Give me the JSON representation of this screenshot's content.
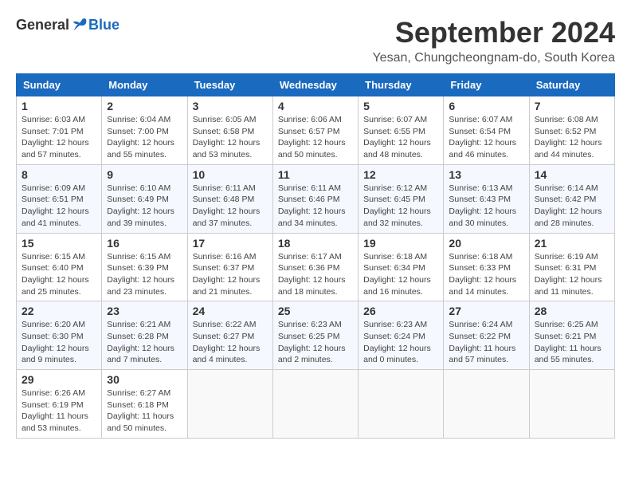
{
  "header": {
    "logo": {
      "general": "General",
      "blue": "Blue"
    },
    "title": "September 2024",
    "location": "Yesan, Chungcheongnam-do, South Korea"
  },
  "calendar": {
    "days_of_week": [
      "Sunday",
      "Monday",
      "Tuesday",
      "Wednesday",
      "Thursday",
      "Friday",
      "Saturday"
    ],
    "weeks": [
      [
        {
          "day": 1,
          "sunrise": "6:03 AM",
          "sunset": "7:01 PM",
          "daylight": "12 hours and 57 minutes."
        },
        {
          "day": 2,
          "sunrise": "6:04 AM",
          "sunset": "7:00 PM",
          "daylight": "12 hours and 55 minutes."
        },
        {
          "day": 3,
          "sunrise": "6:05 AM",
          "sunset": "6:58 PM",
          "daylight": "12 hours and 53 minutes."
        },
        {
          "day": 4,
          "sunrise": "6:06 AM",
          "sunset": "6:57 PM",
          "daylight": "12 hours and 50 minutes."
        },
        {
          "day": 5,
          "sunrise": "6:07 AM",
          "sunset": "6:55 PM",
          "daylight": "12 hours and 48 minutes."
        },
        {
          "day": 6,
          "sunrise": "6:07 AM",
          "sunset": "6:54 PM",
          "daylight": "12 hours and 46 minutes."
        },
        {
          "day": 7,
          "sunrise": "6:08 AM",
          "sunset": "6:52 PM",
          "daylight": "12 hours and 44 minutes."
        }
      ],
      [
        {
          "day": 8,
          "sunrise": "6:09 AM",
          "sunset": "6:51 PM",
          "daylight": "12 hours and 41 minutes."
        },
        {
          "day": 9,
          "sunrise": "6:10 AM",
          "sunset": "6:49 PM",
          "daylight": "12 hours and 39 minutes."
        },
        {
          "day": 10,
          "sunrise": "6:11 AM",
          "sunset": "6:48 PM",
          "daylight": "12 hours and 37 minutes."
        },
        {
          "day": 11,
          "sunrise": "6:11 AM",
          "sunset": "6:46 PM",
          "daylight": "12 hours and 34 minutes."
        },
        {
          "day": 12,
          "sunrise": "6:12 AM",
          "sunset": "6:45 PM",
          "daylight": "12 hours and 32 minutes."
        },
        {
          "day": 13,
          "sunrise": "6:13 AM",
          "sunset": "6:43 PM",
          "daylight": "12 hours and 30 minutes."
        },
        {
          "day": 14,
          "sunrise": "6:14 AM",
          "sunset": "6:42 PM",
          "daylight": "12 hours and 28 minutes."
        }
      ],
      [
        {
          "day": 15,
          "sunrise": "6:15 AM",
          "sunset": "6:40 PM",
          "daylight": "12 hours and 25 minutes."
        },
        {
          "day": 16,
          "sunrise": "6:15 AM",
          "sunset": "6:39 PM",
          "daylight": "12 hours and 23 minutes."
        },
        {
          "day": 17,
          "sunrise": "6:16 AM",
          "sunset": "6:37 PM",
          "daylight": "12 hours and 21 minutes."
        },
        {
          "day": 18,
          "sunrise": "6:17 AM",
          "sunset": "6:36 PM",
          "daylight": "12 hours and 18 minutes."
        },
        {
          "day": 19,
          "sunrise": "6:18 AM",
          "sunset": "6:34 PM",
          "daylight": "12 hours and 16 minutes."
        },
        {
          "day": 20,
          "sunrise": "6:18 AM",
          "sunset": "6:33 PM",
          "daylight": "12 hours and 14 minutes."
        },
        {
          "day": 21,
          "sunrise": "6:19 AM",
          "sunset": "6:31 PM",
          "daylight": "12 hours and 11 minutes."
        }
      ],
      [
        {
          "day": 22,
          "sunrise": "6:20 AM",
          "sunset": "6:30 PM",
          "daylight": "12 hours and 9 minutes."
        },
        {
          "day": 23,
          "sunrise": "6:21 AM",
          "sunset": "6:28 PM",
          "daylight": "12 hours and 7 minutes."
        },
        {
          "day": 24,
          "sunrise": "6:22 AM",
          "sunset": "6:27 PM",
          "daylight": "12 hours and 4 minutes."
        },
        {
          "day": 25,
          "sunrise": "6:23 AM",
          "sunset": "6:25 PM",
          "daylight": "12 hours and 2 minutes."
        },
        {
          "day": 26,
          "sunrise": "6:23 AM",
          "sunset": "6:24 PM",
          "daylight": "12 hours and 0 minutes."
        },
        {
          "day": 27,
          "sunrise": "6:24 AM",
          "sunset": "6:22 PM",
          "daylight": "11 hours and 57 minutes."
        },
        {
          "day": 28,
          "sunrise": "6:25 AM",
          "sunset": "6:21 PM",
          "daylight": "11 hours and 55 minutes."
        }
      ],
      [
        {
          "day": 29,
          "sunrise": "6:26 AM",
          "sunset": "6:19 PM",
          "daylight": "11 hours and 53 minutes."
        },
        {
          "day": 30,
          "sunrise": "6:27 AM",
          "sunset": "6:18 PM",
          "daylight": "11 hours and 50 minutes."
        },
        null,
        null,
        null,
        null,
        null
      ]
    ]
  }
}
